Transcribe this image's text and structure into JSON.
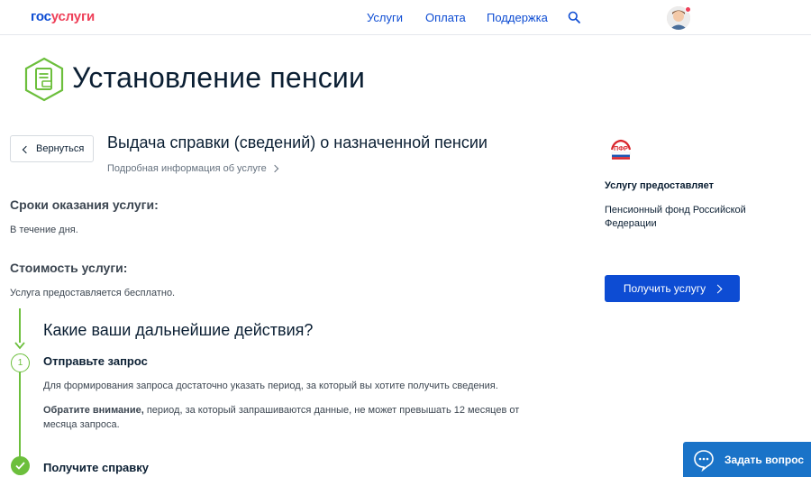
{
  "header": {
    "logo_part1": "гос",
    "logo_part2": "услуги",
    "nav": [
      "Услуги",
      "Оплата",
      "Поддержка"
    ]
  },
  "page": {
    "title": "Установление пенсии"
  },
  "service": {
    "back_label": "Вернуться",
    "title": "Выдача справки (сведений) о назначенной пенсии",
    "info_link": "Подробная информация об услуге",
    "terms_heading": "Сроки оказания услуги:",
    "terms_text": "В течение дня.",
    "cost_heading": "Стоимость услуги:",
    "cost_text": "Услуга предоставляется бесплатно."
  },
  "actions": {
    "heading": "Какие ваши дальнейшие действия?",
    "step1_number": "1",
    "step1_title": "Отправьте запрос",
    "step1_text": "Для формирования запроса достаточно указать период, за который вы хотите получить сведения.",
    "step1_note_bold": "Обратите внимание,",
    "step1_note_text": " период, за который запрашиваются данные, не может превышать 12 месяцев от месяца запроса.",
    "step2_title": "Получите справку"
  },
  "provider": {
    "heading": "Услугу предоставляет",
    "name": "Пенсионный фонд Российской Федерации",
    "cta_label": "Получить услугу"
  },
  "support": {
    "ask_label": "Задать вопрос"
  },
  "colors": {
    "brand_blue": "#0d4cd3",
    "brand_red": "#ee3f58",
    "step_green": "#6cbf3c",
    "support_blue": "#1a73c8"
  }
}
